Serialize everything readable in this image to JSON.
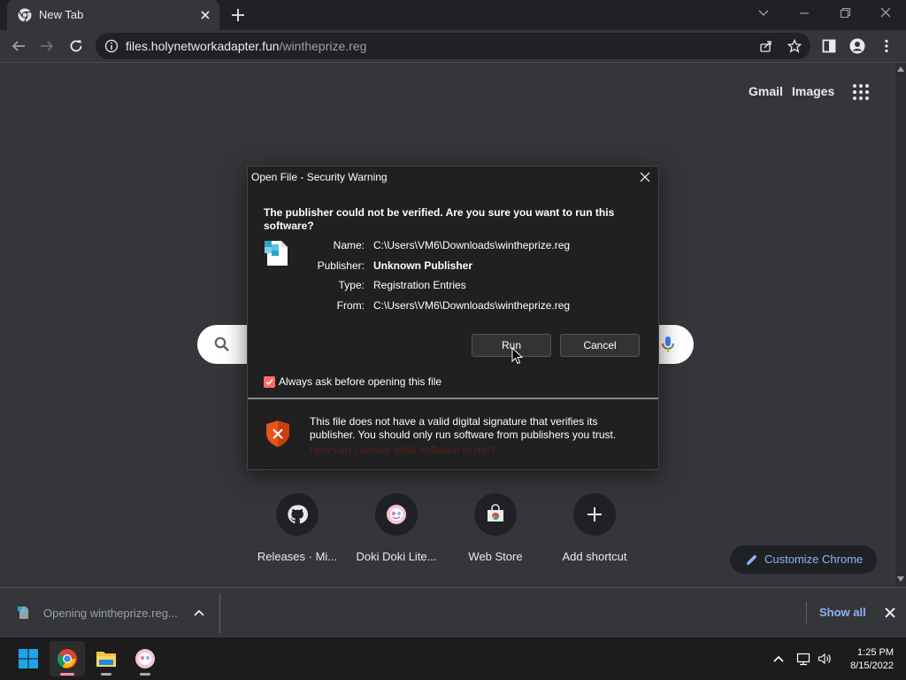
{
  "browser": {
    "tab": {
      "title": "New Tab"
    },
    "address": {
      "host": "files.holynetworkadapter.fun",
      "path": "/wintheprize.reg"
    }
  },
  "ntp": {
    "gmail": "Gmail",
    "images": "Images",
    "shortcuts": [
      {
        "label": "Releases · Mi...",
        "icon": "github-icon"
      },
      {
        "label": "Doki Doki Lite...",
        "icon": "doki-doki-icon"
      },
      {
        "label": "Web Store",
        "icon": "web-store-icon"
      },
      {
        "label": "Add shortcut",
        "icon": "plus-icon"
      }
    ],
    "customize": "Customize Chrome"
  },
  "dialog": {
    "title": "Open File - Security Warning",
    "question": "The publisher could not be verified.  Are you sure you want to run this software?",
    "rows": [
      {
        "label": "Name:",
        "value": "C:\\Users\\VM6\\Downloads\\wintheprize.reg"
      },
      {
        "label": "Publisher:",
        "value": "Unknown Publisher"
      },
      {
        "label": "Type:",
        "value": "Registration Entries"
      },
      {
        "label": "From:",
        "value": "C:\\Users\\VM6\\Downloads\\wintheprize.reg"
      }
    ],
    "run": "Run",
    "cancel": "Cancel",
    "checkbox_label": "Always ask before opening this file",
    "checkbox_checked": true,
    "warning": "This file does not have a valid digital signature that verifies its publisher.  You should only run software from publishers you trust.",
    "warning_link": "How can I decide what software to run?"
  },
  "downloads": {
    "item": "Opening wintheprize.reg...",
    "show_all": "Show all"
  },
  "taskbar": {
    "time": "1:25 PM",
    "date": "8/15/2022"
  },
  "colors": {
    "accent_blue": "#8ab4f8",
    "checkbox": "#ff6b6b",
    "shield": "#e8541c"
  }
}
